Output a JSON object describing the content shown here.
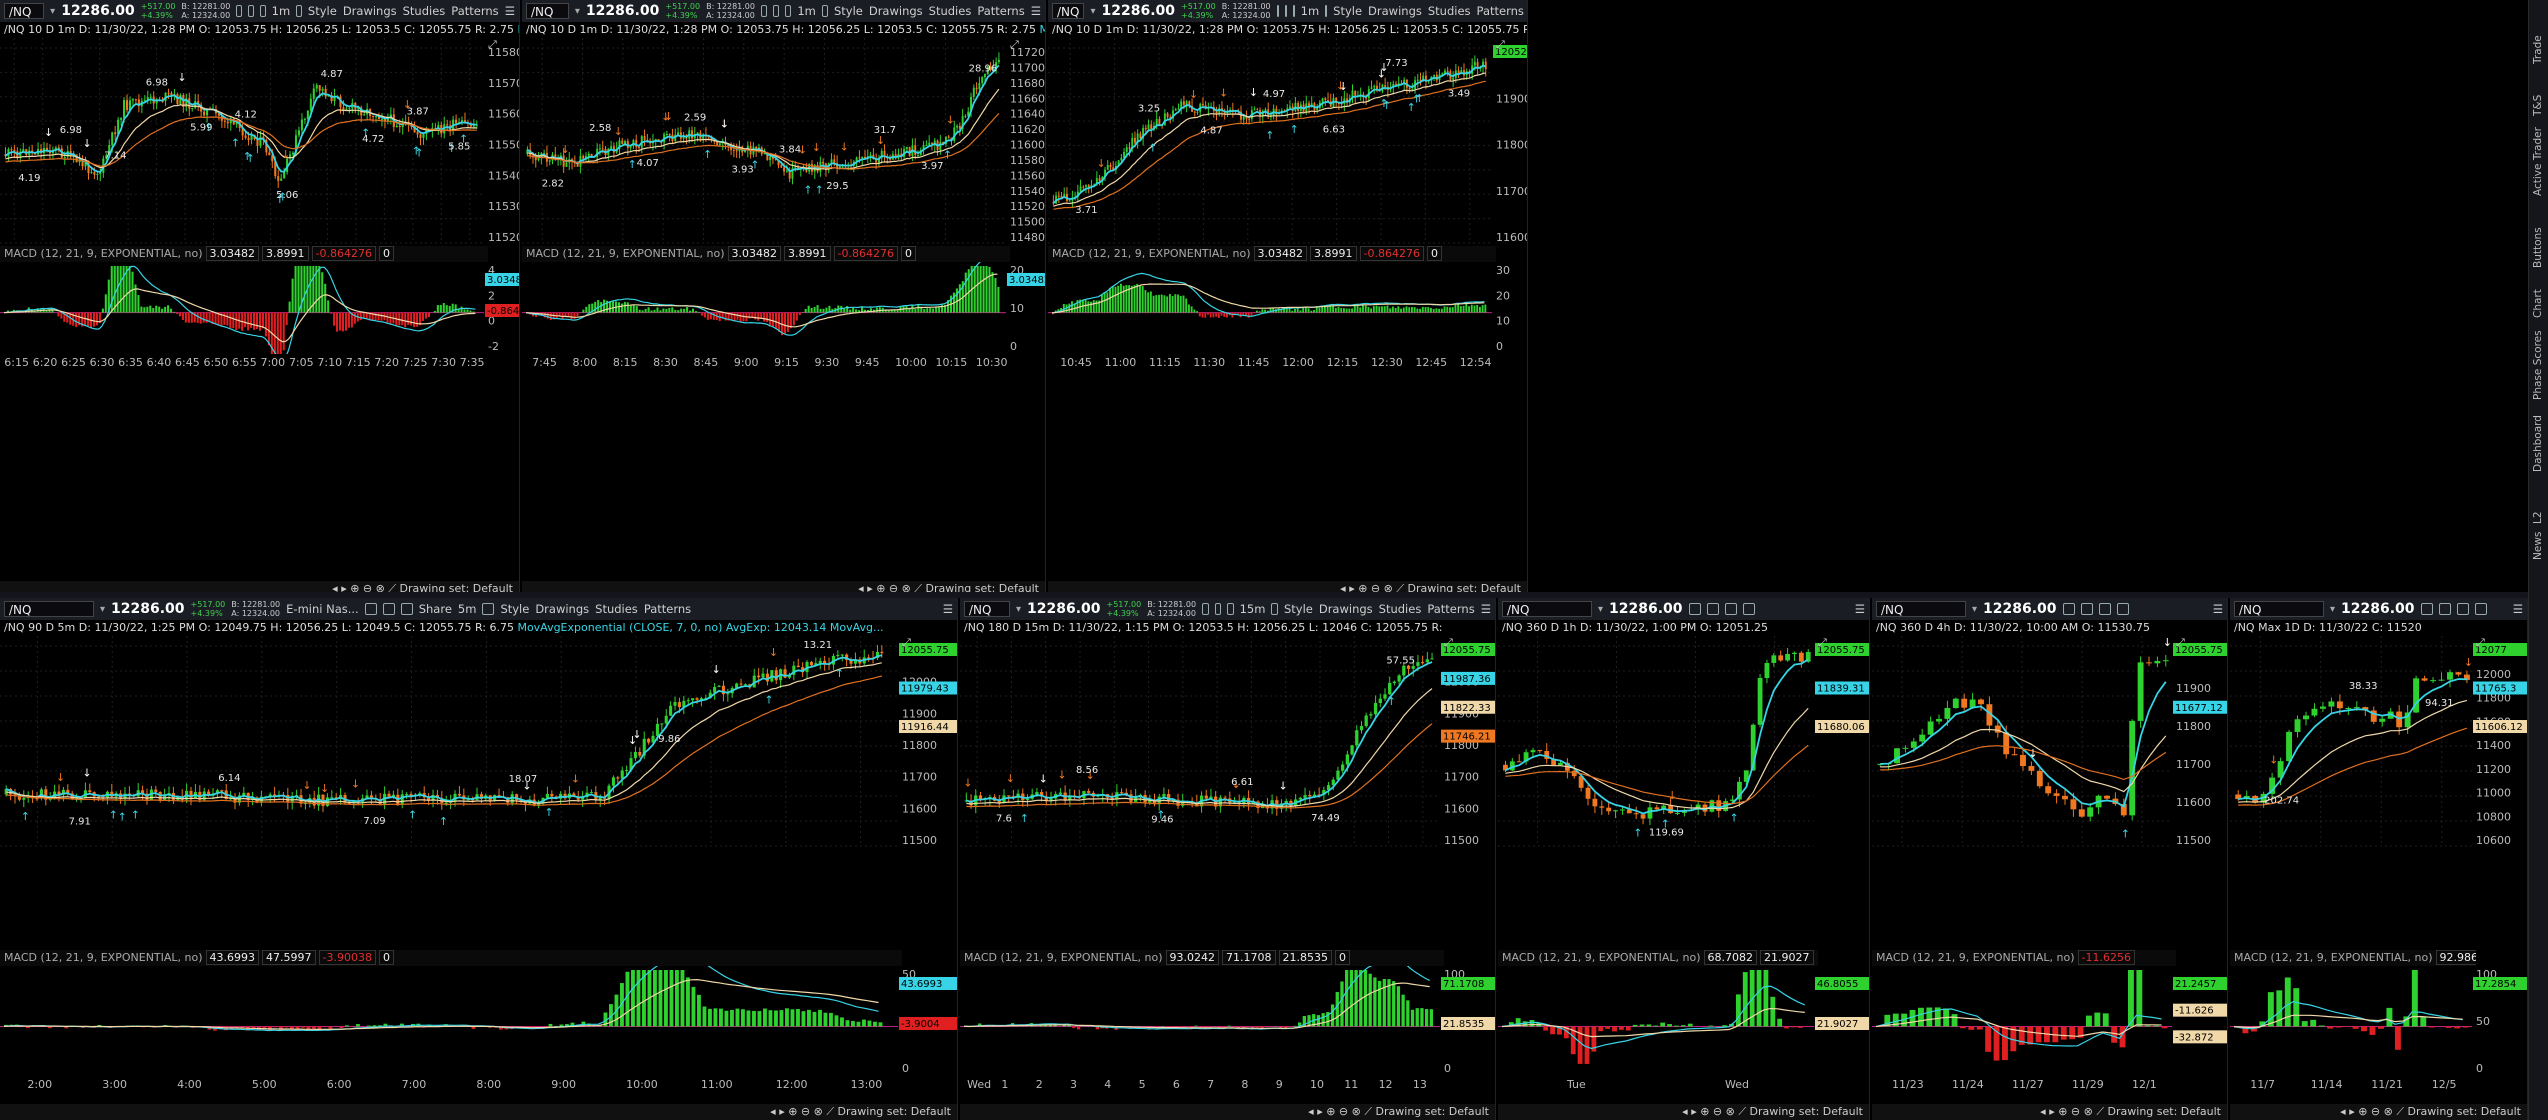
{
  "symbol": "/NQ",
  "last_price": "12286.00",
  "change": "+517.00",
  "change_pct": "+4.39%",
  "bid": "B: 12281.00",
  "ask": "A: 12324.00",
  "toolbar": {
    "style": "Style",
    "drawings": "Drawings",
    "studies": "Studies",
    "patterns": "Patterns",
    "share": "Share",
    "contract_name": "E-mini Nas..."
  },
  "macd_study": "MACD (12, 21, 9, EXPONENTIAL, no)",
  "drawing_set": "Drawing set: Default",
  "side_tabs": [
    "Trade",
    "T&S",
    "Active Trader",
    "Buttons",
    "Chart",
    "Phase Scores",
    "Dashboard",
    "L2",
    "News"
  ],
  "colors": {
    "up": "#2fd12f",
    "down": "#f07820",
    "ema_fast": "#36d4e6",
    "ema_mid": "#f0d8a8",
    "ema_slow": "#e07020",
    "macd_pos": "#2fd12f",
    "macd_neg": "#e02020"
  },
  "panels": [
    {
      "id": "p1",
      "title": "/NQ 10 D 1m",
      "agg": "1m",
      "ohlc": "D: 11/30/22, 1:28 PM   O: 12053.75   H: 12056.25   L: 12053.5   C: 12055.75   R: 2.75",
      "study": "MovAvgExponential (CLOSE, 7, 0, no)",
      "macd_values": [
        "3.03482",
        "3.8991",
        "-0.864276",
        "0"
      ],
      "y_ticks": [
        "11580",
        "11570",
        "11560",
        "11550",
        "11540",
        "11530",
        "11520"
      ],
      "x_ticks": [
        "6:15",
        "6:20",
        "6:25",
        "6:30",
        "6:35",
        "6:40",
        "6:45",
        "6:50",
        "6:55",
        "7:00",
        "7:05",
        "7:10",
        "7:15",
        "7:20",
        "7:25",
        "7:30",
        "7:35"
      ],
      "macd_ticks": [
        "4",
        "2",
        "0",
        "-2"
      ],
      "macd_tag_pos": "3.03482",
      "macd_tag_neg": "-0.8642",
      "labels": [
        "4.19",
        "6.98",
        "7.14",
        "6.98",
        "5.99",
        "4.12",
        "5.06",
        "4.87",
        "4.72",
        "3.87",
        "5.85"
      ]
    },
    {
      "id": "p2",
      "title": "/NQ 10 D 1m",
      "agg": "1m",
      "ohlc": "D: 11/30/22, 1:28 PM   O: 12053.75   H: 12056.25   L: 12053.5   C: 12055.75   R: 2.75",
      "study": "MovAvgExponential (CLOSE, 7, 0, no)",
      "macd_values": [
        "3.03482",
        "3.8991",
        "-0.864276",
        "0"
      ],
      "y_ticks": [
        "11720",
        "11700",
        "11680",
        "11660",
        "11640",
        "11620",
        "11600",
        "11580",
        "11560",
        "11540",
        "11520",
        "11500",
        "11480"
      ],
      "x_ticks": [
        "7:45",
        "8:00",
        "8:15",
        "8:30",
        "8:45",
        "9:00",
        "9:15",
        "9:30",
        "9:45",
        "10:00",
        "10:15",
        "10:30"
      ],
      "macd_ticks": [
        "20",
        "10",
        "0"
      ],
      "macd_tag_pos": "3.03482",
      "labels": [
        "2.82",
        "2.58",
        "4.07",
        "2.59",
        "3.93",
        "3.84",
        "29.5",
        "31.7",
        "3.97",
        "28.96"
      ]
    },
    {
      "id": "p3",
      "title": "/NQ 10 D 1m",
      "agg": "1m",
      "ohlc": "D: 11/30/22, 1:28 PM   O: 12053.75   H: 12056.25   L: 12053.5   C: 12055.75   R: 2.75",
      "study": "MovAvgExponential (CLOSE, 7, 0, no)",
      "macd_values": [
        "3.03482",
        "3.8991",
        "-0.864276",
        "0"
      ],
      "y_ticks": [
        "12000",
        "11900",
        "11800",
        "11700",
        "11600"
      ],
      "x_ticks": [
        "10:45",
        "11:00",
        "11:15",
        "11:30",
        "11:45",
        "12:00",
        "12:15",
        "12:30",
        "12:45",
        "12:54"
      ],
      "macd_ticks": [
        "30",
        "20",
        "10",
        "0"
      ],
      "price_tag": "12052.82",
      "labels": [
        "3.71",
        "3.25",
        "4.87",
        "4.97",
        "6.63",
        "7.73",
        "3.49"
      ]
    },
    {
      "id": "p4",
      "title": "/NQ 90 D 5m",
      "agg": "5m",
      "ohlc": "D: 11/30/22, 1:25 PM   O: 12049.75   H: 12056.25   L: 12049.5   C: 12055.75   R: 6.75",
      "study": "MovAvgExponential (CLOSE, 7, 0, no)   AvgExp: 12043.14   MovAvg...",
      "macd_values": [
        "43.6993",
        "47.5997",
        "-3.90038",
        "0"
      ],
      "y_ticks": [
        "12100",
        "12000",
        "11900",
        "11800",
        "11700",
        "11600",
        "11500"
      ],
      "x_ticks": [
        "2:00",
        "3:00",
        "4:00",
        "5:00",
        "6:00",
        "7:00",
        "8:00",
        "9:00",
        "10:00",
        "11:00",
        "12:00",
        "13:00"
      ],
      "macd_ticks": [
        "50",
        "0"
      ],
      "price_tags": [
        "12055.75",
        "11979.43",
        "11916.44"
      ],
      "macd_tag_pos": "43.6993",
      "macd_tag_neg": "-3.9004",
      "labels": [
        "7.91",
        "6.14",
        "7.09",
        "18.07",
        "9.86",
        "13.21"
      ]
    },
    {
      "id": "p5",
      "title": "/NQ 180 D 15m",
      "agg": "15m",
      "ohlc": "D: 11/30/22, 1:15 PM   O: 12053.5   H: 12056.25   L: 12046   C: 12055.75   R:",
      "study": "",
      "macd_values": [
        "93.0242",
        "71.1708",
        "21.8535",
        "0"
      ],
      "y_ticks": [
        "12100",
        "12000",
        "11900",
        "11800",
        "11700",
        "11600",
        "11500"
      ],
      "x_ticks": [
        "Wed",
        "1",
        "2",
        "3",
        "4",
        "5",
        "6",
        "7",
        "8",
        "9",
        "10",
        "11",
        "12",
        "13"
      ],
      "macd_ticks": [
        "100",
        "50",
        "0"
      ],
      "price_tags": [
        "12055.75",
        "11987.36",
        "11822.33",
        "11746.21"
      ],
      "macd_tags": [
        "71.1708",
        "21.8535"
      ],
      "labels": [
        "7.6",
        "8.56",
        "9.46",
        "6.61",
        "74.49",
        "57.55"
      ]
    },
    {
      "id": "p6",
      "title": "/NQ 360 D 1h",
      "agg": "",
      "ohlc": "D: 11/30/22, 1:00 PM   O: 12051.25",
      "study": "",
      "macd_values": [
        "68.7082",
        "21.9027"
      ],
      "y_ticks": [],
      "x_ticks": [
        "Tue",
        "Wed"
      ],
      "macd_ticks": [],
      "price_tags": [
        "12055.75",
        "11839.31",
        "11680.06"
      ],
      "macd_tags": [
        "46.8055",
        "21.9027"
      ],
      "labels": [
        "119.69"
      ]
    },
    {
      "id": "p7",
      "title": "/NQ 360 D 4h",
      "agg": "",
      "ohlc": "D: 11/30/22, 10:00 AM   O: 11530.75",
      "study": "",
      "macd_values": [
        "-11.6256"
      ],
      "y_ticks": [
        "12000",
        "11900",
        "11800",
        "11700",
        "11600",
        "11500"
      ],
      "x_ticks": [
        "11/23",
        "11/24",
        "11/27",
        "11/29",
        "12/1"
      ],
      "macd_ticks": [],
      "price_tags": [
        "12055.75",
        "11677.12"
      ],
      "macd_tags": [
        "21.2457",
        "-11.626",
        "-32.872"
      ],
      "labels": []
    },
    {
      "id": "p8",
      "title": "/NQ Max 1D",
      "agg": "",
      "ohlc": "D: 11/30/22   C: 11520",
      "study": "",
      "macd_values": [
        "92.9869"
      ],
      "y_ticks": [
        "12200",
        "12000",
        "11800",
        "11600",
        "11400",
        "11200",
        "11000",
        "10800",
        "10600"
      ],
      "x_ticks": [
        "11/7",
        "11/14",
        "11/21",
        "12/5"
      ],
      "macd_ticks": [
        "100",
        "50",
        "0"
      ],
      "price_tags": [
        "12077",
        "11765.3",
        "11606.12"
      ],
      "macd_tags": [
        "17.2854"
      ],
      "labels": [
        "202.74",
        "38.33",
        "94.31"
      ]
    }
  ]
}
